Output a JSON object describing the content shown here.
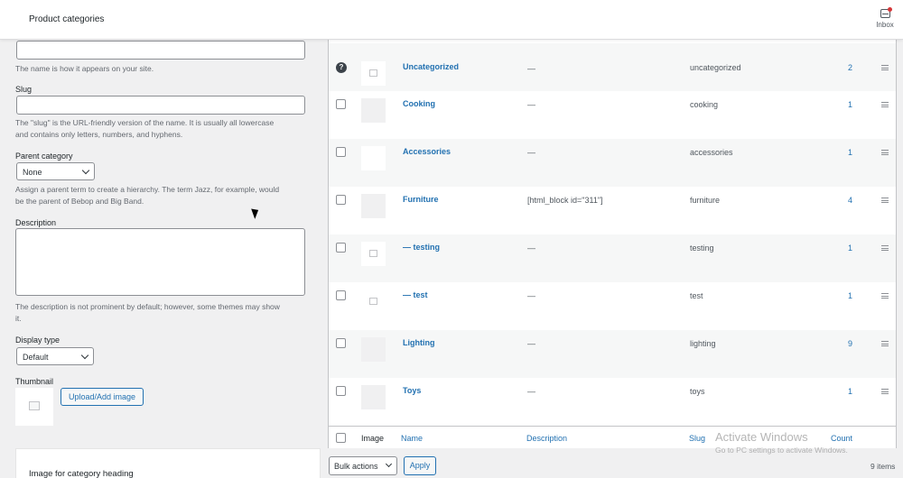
{
  "header": {
    "title": "Product categories",
    "inbox_label": "Inbox"
  },
  "form": {
    "name_help": "The name is how it appears on your site.",
    "slug_label": "Slug",
    "slug_help_1": "The \"slug\" is the URL-friendly version of the name. It is usually all lowercase",
    "slug_help_2": "and contains only letters, numbers, and hyphens.",
    "parent_label": "Parent category",
    "parent_value": "None",
    "parent_help_1": "Assign a parent term to create a hierarchy. The term Jazz, for example, would",
    "parent_help_2": "be the parent of Bebop and Big Band.",
    "description_label": "Description",
    "description_help_1": "The description is not prominent by default; however, some themes may show",
    "description_help_2": "it.",
    "display_type_label": "Display type",
    "display_type_value": "Default",
    "thumbnail_label": "Thumbnail",
    "upload_button": "Upload/Add image",
    "image_heading_label": "Image for category heading"
  },
  "table": {
    "rows": [
      {
        "name": "Uncategorized",
        "description": "—",
        "slug": "uncategorized",
        "count": "2"
      },
      {
        "name": "Cooking",
        "description": "—",
        "slug": "cooking",
        "count": "1"
      },
      {
        "name": "Accessories",
        "description": "—",
        "slug": "accessories",
        "count": "1"
      },
      {
        "name": "Furniture",
        "description": "[html_block id=\"311\"]",
        "slug": "furniture",
        "count": "4"
      },
      {
        "name": "— testing",
        "description": "—",
        "slug": "testing",
        "count": "1"
      },
      {
        "name": "— test",
        "description": "—",
        "slug": "test",
        "count": "1"
      },
      {
        "name": "Lighting",
        "description": "—",
        "slug": "lighting",
        "count": "9"
      },
      {
        "name": "Toys",
        "description": "—",
        "slug": "toys",
        "count": "1"
      }
    ],
    "footer": {
      "image": "Image",
      "name": "Name",
      "description": "Description",
      "slug": "Slug",
      "count": "Count"
    },
    "bulk_actions": "Bulk actions",
    "apply": "Apply",
    "items_count": "9 items"
  },
  "watermark": {
    "line1": "Activate Windows",
    "line2": "Go to PC settings to activate Windows."
  }
}
